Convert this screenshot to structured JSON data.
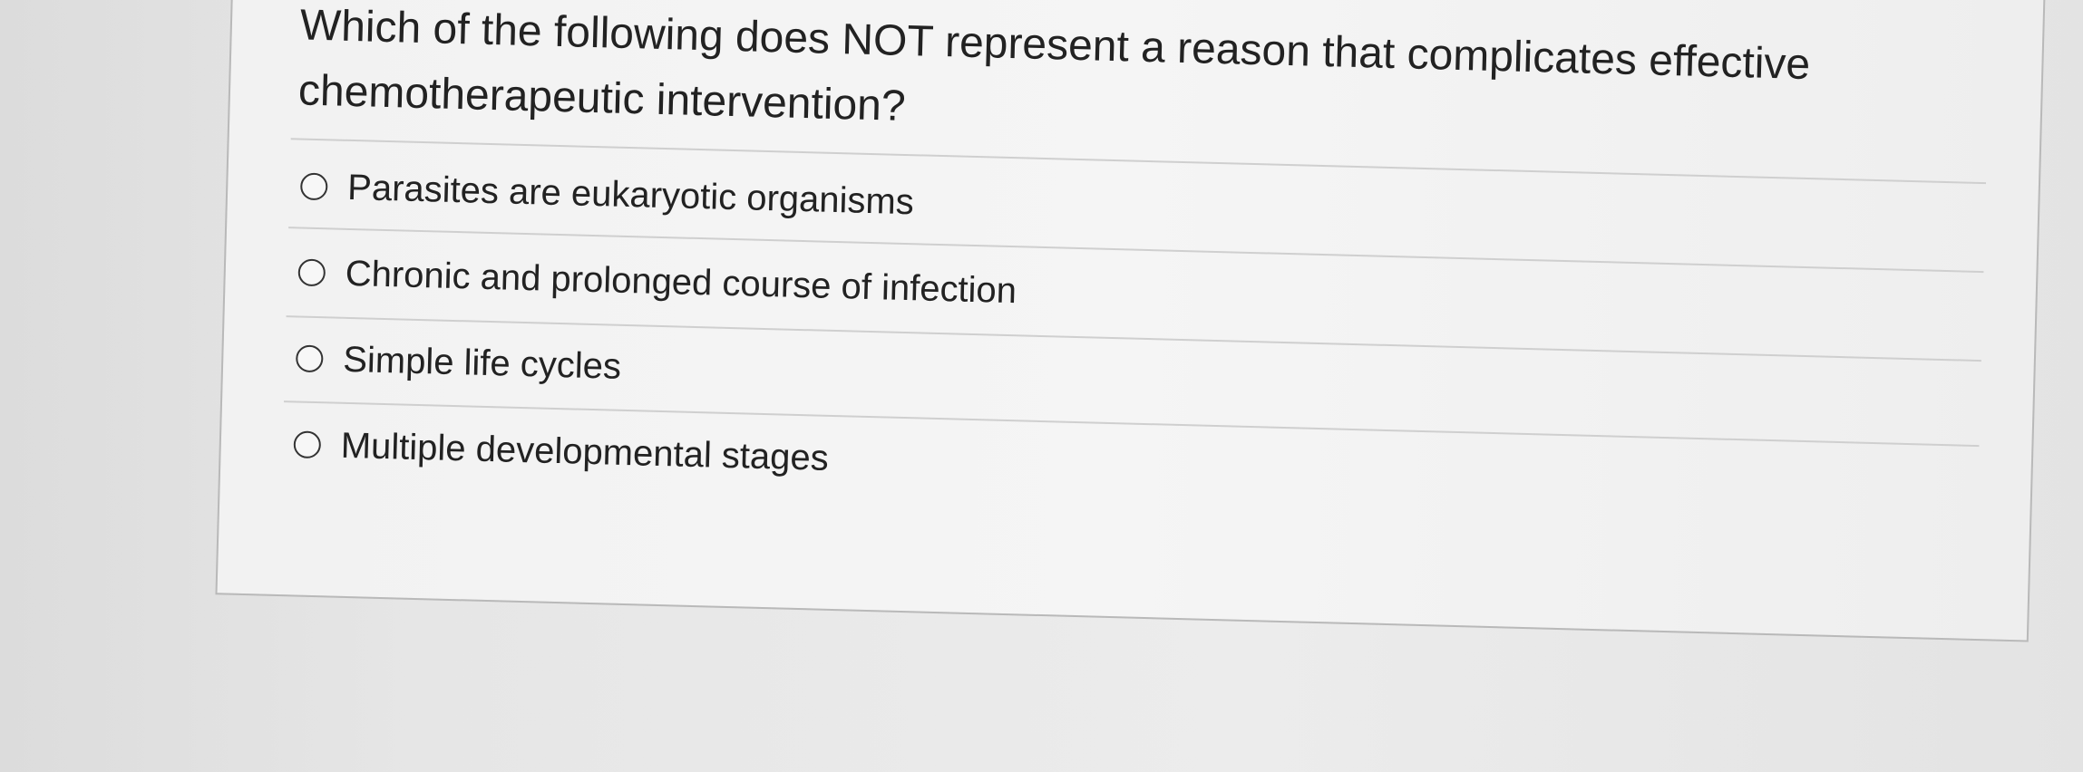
{
  "question": {
    "text": "Which of the following does NOT represent a reason that complicates effective chemotherapeutic intervention?"
  },
  "options": [
    {
      "label": "Parasites are eukaryotic organisms",
      "selected": false
    },
    {
      "label": "Chronic and prolonged course of infection",
      "selected": false
    },
    {
      "label": "Simple life cycles",
      "selected": false
    },
    {
      "label": "Multiple developmental stages",
      "selected": false
    }
  ]
}
